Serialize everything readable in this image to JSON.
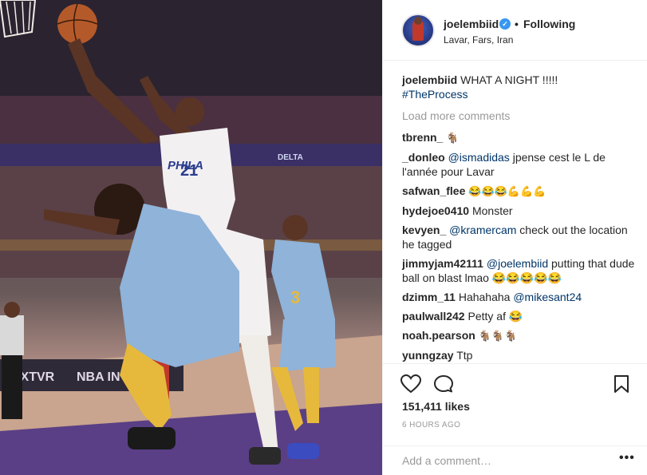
{
  "post": {
    "username": "joelembiid",
    "follow_label": "Following",
    "separator": "•",
    "location": "Lavar, Fars, Iran",
    "verified_icon": "verified-check-icon"
  },
  "caption": {
    "user": "joelembiid",
    "text": "WHAT A NIGHT !!!!!",
    "hashtag": "#TheProcess"
  },
  "load_more": "Load more comments",
  "comments": [
    {
      "user": "tbrenn_",
      "mention": "",
      "text": "🐐"
    },
    {
      "user": "_donleo",
      "mention": "@ismadidas",
      "text": "jpense cest le L de l'année pour Lavar"
    },
    {
      "user": "safwan_flee",
      "mention": "",
      "text": "😂😂😂💪💪💪"
    },
    {
      "user": "hydejoe0410",
      "mention": "",
      "text": "Monster"
    },
    {
      "user": "kevyen_",
      "mention": "@kramercam",
      "text": "check out the location he tagged"
    },
    {
      "user": "jimmyjam42111",
      "mention": "@joelembiid",
      "text": "putting that dude ball on blast lmao 😂😂😂😂😂"
    },
    {
      "user": "dzimm_11",
      "mention": "",
      "text": "Hahahaha",
      "mention_after": "@mikesant24"
    },
    {
      "user": "paulwall242",
      "mention": "",
      "text": "Petty af 😂"
    },
    {
      "user": "noah.pearson",
      "mention": "",
      "text": "🐐🐐🐐"
    },
    {
      "user": "yunngzay",
      "mention": "",
      "text": "Ttp"
    }
  ],
  "stats": {
    "likes": "151,411 likes",
    "time": "6 HOURS AGO"
  },
  "add_comment": {
    "placeholder": "Add a comment…",
    "more": "•••"
  },
  "icons": {
    "like": "heart-icon",
    "comment": "comment-bubble-icon",
    "save": "bookmark-icon"
  },
  "photo": {
    "jersey_team": "PHILA",
    "jersey_number": "21",
    "opponent_number": "3",
    "banner": "DELTA",
    "court_ad_1": "NXTVR",
    "court_ad_2": "NBA IN"
  }
}
